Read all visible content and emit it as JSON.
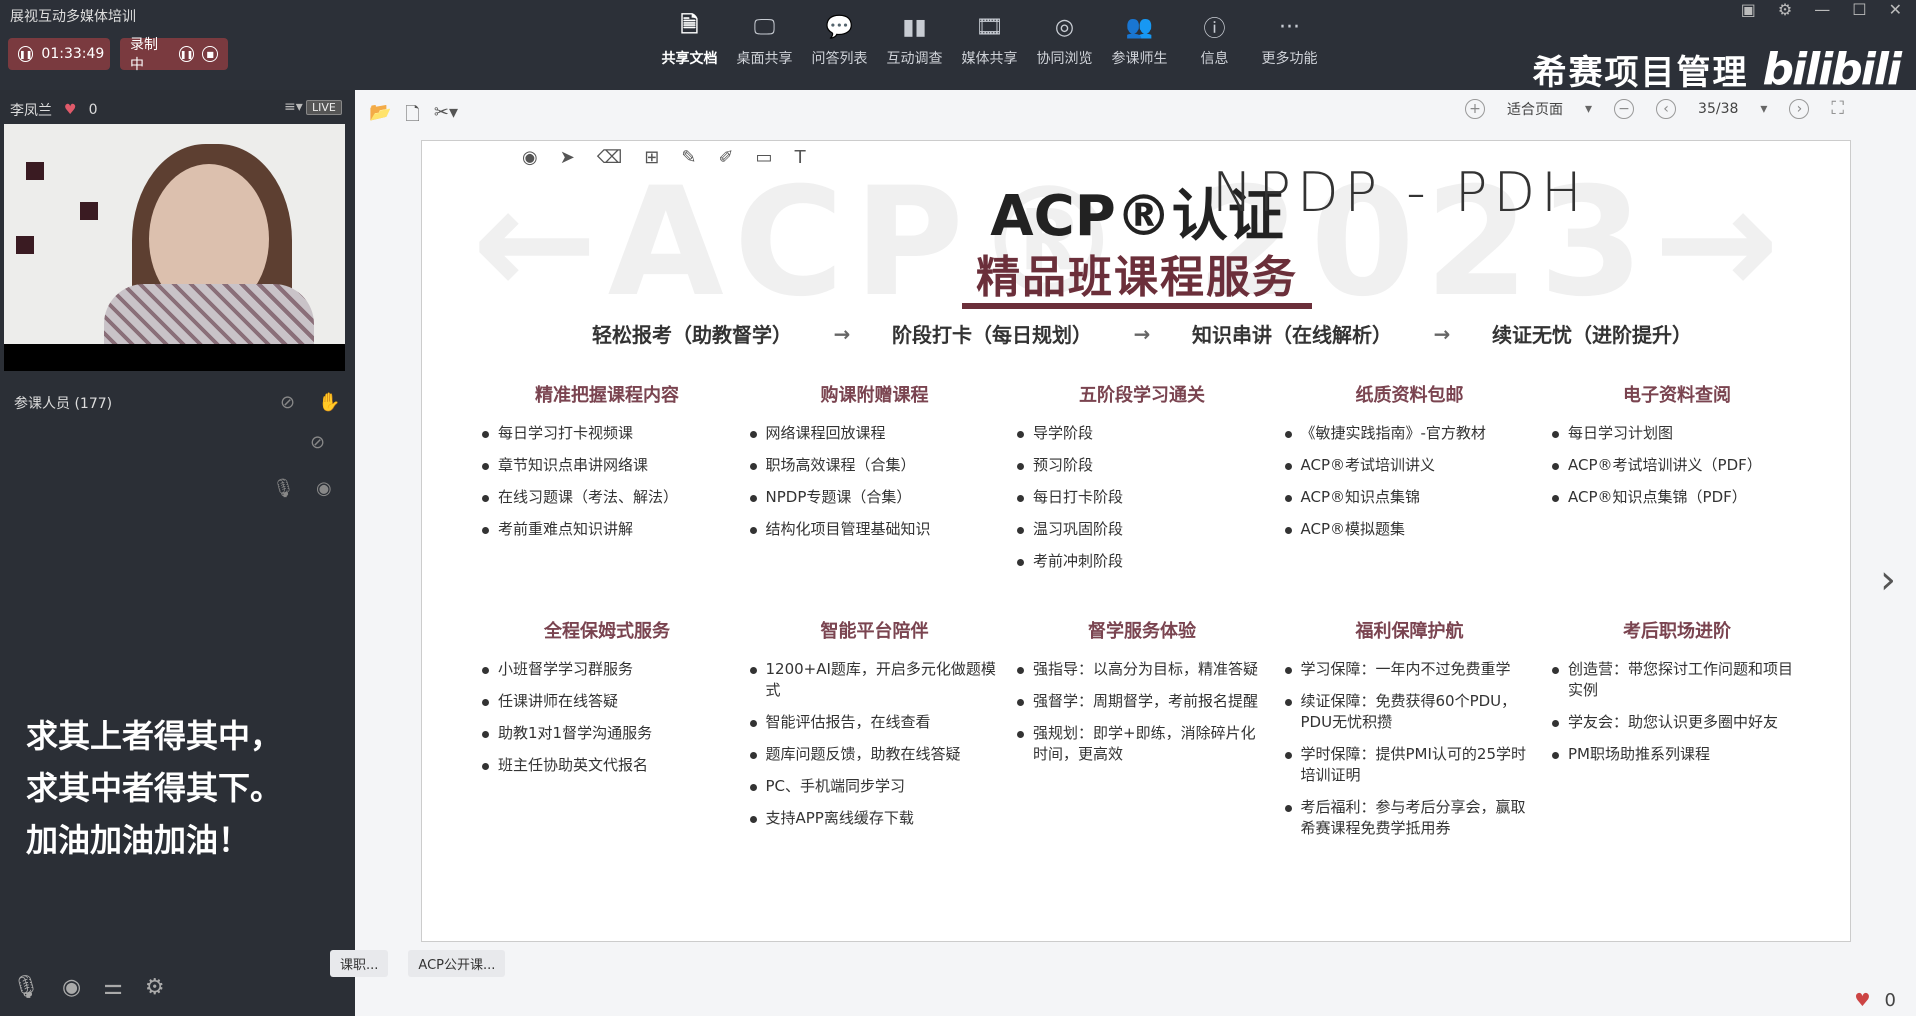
{
  "app": {
    "title": "展视互动多媒体培训",
    "timer": "01:33:49",
    "recording": "录制中"
  },
  "toolbar": [
    {
      "label": "共享文档",
      "icon": "document-icon"
    },
    {
      "label": "桌面共享",
      "icon": "desktop-icon"
    },
    {
      "label": "问答列表",
      "icon": "chat-icon"
    },
    {
      "label": "互动调查",
      "icon": "bar-chart-icon"
    },
    {
      "label": "媒体共享",
      "icon": "film-icon"
    },
    {
      "label": "协同浏览",
      "icon": "compass-icon"
    },
    {
      "label": "参课师生",
      "icon": "people-icon"
    },
    {
      "label": "信息",
      "icon": "info-icon"
    },
    {
      "label": "更多功能",
      "icon": "more-icon"
    }
  ],
  "brand": {
    "name": "希赛项目管理",
    "logo": "bilibili"
  },
  "speaker": {
    "name": "李凤兰",
    "likes": "0",
    "live": "LIVE"
  },
  "participants": "参课人员 (177)",
  "motto": [
    "求其上者得其中，",
    "求其中者得其下。",
    "加油加油加油！"
  ],
  "viewer": {
    "fit": "适合页面",
    "page": "35/38"
  },
  "slide": {
    "watermark": "←ACP® 2023→",
    "title": "ACP®认证",
    "subtitle": "精品班课程服务",
    "handwriting": "NPDP - PDH",
    "flow": [
      "轻松报考（助教督学）",
      "阶段打卡（每日规划）",
      "知识串讲（在线解析）",
      "续证无忧（进阶提升）"
    ],
    "row1": [
      {
        "title": "精准把握课程内容",
        "items": [
          "每日学习打卡视频课",
          "章节知识点串讲网络课",
          "在线习题课（考法、解法）",
          "考前重难点知识讲解"
        ]
      },
      {
        "title": "购课附赠课程",
        "items": [
          "网络课程回放课程",
          "职场高效课程（合集）",
          "NPDP专题课（合集）",
          "结构化项目管理基础知识"
        ]
      },
      {
        "title": "五阶段学习通关",
        "items": [
          "导学阶段",
          "预习阶段",
          "每日打卡阶段",
          "温习巩固阶段",
          "考前冲刺阶段"
        ]
      },
      {
        "title": "纸质资料包邮",
        "items": [
          "《敏捷实践指南》-官方教材",
          "ACP®考试培训讲义",
          "ACP®知识点集锦",
          "ACP®模拟题集"
        ]
      },
      {
        "title": "电子资料查阅",
        "items": [
          "每日学习计划图",
          "ACP®考试培训讲义（PDF）",
          "ACP®知识点集锦（PDF）"
        ]
      }
    ],
    "row2": [
      {
        "title": "全程保姆式服务",
        "items": [
          "小班督学学习群服务",
          "任课讲师在线答疑",
          "助教1对1督学沟通服务",
          "班主任协助英文代报名"
        ]
      },
      {
        "title": "智能平台陪伴",
        "items": [
          "1200+AI题库，开启多元化做题模式",
          "智能评估报告，在线查看",
          "题库问题反馈，助教在线答疑",
          "PC、手机端同步学习",
          "支持APP离线缓存下载"
        ]
      },
      {
        "title": "督学服务体验",
        "items": [
          "强指导：以高分为目标，精准答疑",
          "强督学：周期督学，考前报名提醒",
          "强规划：即学+即练，消除碎片化时间，更高效"
        ]
      },
      {
        "title": "福利保障护航",
        "items": [
          "学习保障：一年内不过免费重学",
          "续证保障：免费获得60个PDU，PDU无忧积攒",
          "学时保障：提供PMI认可的25学时培训证明",
          "考后福利：参与考后分享会，赢取希赛课程免费学抵用券"
        ]
      },
      {
        "title": "考后职场进阶",
        "items": [
          "创造营：带您探讨工作问题和项目实例",
          "学友会：助您认识更多圈中好友",
          "PM职场助推系列课程"
        ]
      }
    ]
  },
  "tabs": [
    "课职...",
    "ACP公开课..."
  ],
  "status": {
    "likes": "0"
  }
}
